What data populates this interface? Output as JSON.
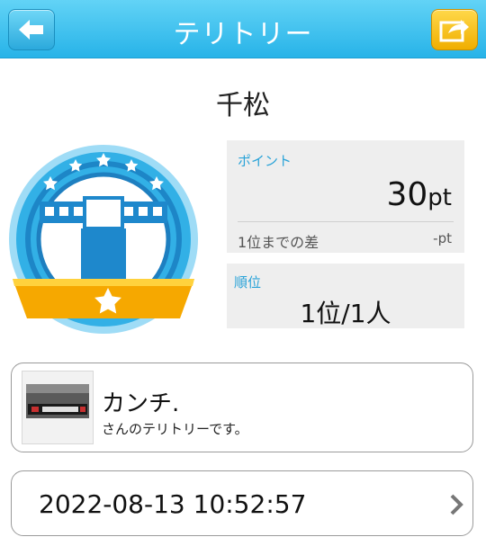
{
  "header": {
    "title": "テリトリー",
    "back_icon": "arrow-left-icon",
    "share_icon": "share-export-icon",
    "back_color": "#2ba9dc",
    "share_color": "#f0ae00"
  },
  "territory": {
    "name": "千松",
    "emblem_icon": "gate-emblem-icon"
  },
  "points": {
    "label": "ポイント",
    "value": "30",
    "unit": "pt",
    "diff_label": "1位までの差",
    "diff_value": "-pt"
  },
  "rank": {
    "label": "順位",
    "value": "1位/1人"
  },
  "owner": {
    "name": "カンチ.",
    "subtitle": "さんのテリトリーです。",
    "avatar_icon": "mugen-avatar-image"
  },
  "datetime": {
    "value": "2022-08-13 10:52:57",
    "chevron_icon": "chevron-right-icon"
  }
}
